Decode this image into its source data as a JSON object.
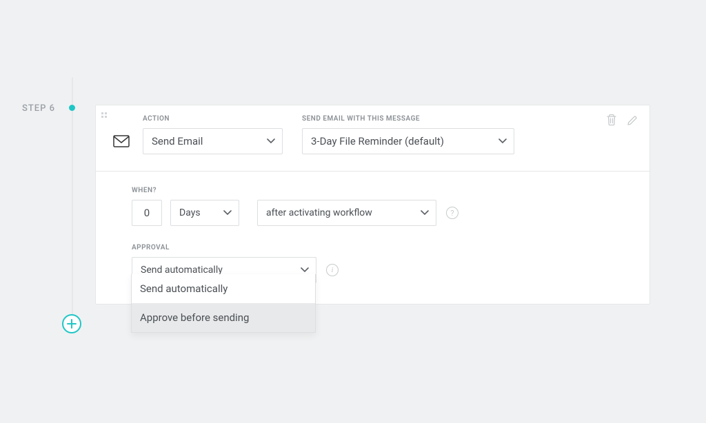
{
  "step": {
    "label": "STEP 6"
  },
  "labels": {
    "action": "ACTION",
    "message": "SEND EMAIL WITH THIS MESSAGE",
    "when": "WHEN?",
    "approval": "APPROVAL"
  },
  "values": {
    "action": "Send Email",
    "message": "3-Day File Reminder (default)",
    "whenNumber": "0",
    "whenUnit": "Days",
    "whenRelative": "after activating workflow",
    "approvalSelected": "Send automatically"
  },
  "approvalOptions": [
    "Send automatically",
    "Approve before sending"
  ],
  "icons": {
    "help": "?",
    "info": "i"
  }
}
